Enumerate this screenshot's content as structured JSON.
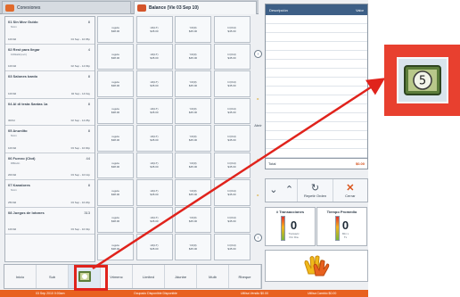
{
  "tabs": [
    {
      "label": "Conexiones"
    },
    {
      "label": "Balance (Vie 03 Sep 10)"
    }
  ],
  "info": {
    "col_desc": "Descripción",
    "col_value": "Valor",
    "total_label": "Total",
    "total_value": "$0.00"
  },
  "orders": [
    {
      "name": "01  Sin Mov Guido",
      "qty": "8",
      "sub": "Nicm",
      "time": "10h/0d",
      "date": "04 Sep - 10:05p"
    },
    {
      "name": "02  Rest para llegar",
      "qty": "4",
      "sub": "100kalin(ovn)",
      "time": "10h/3d",
      "date": "02 Sep - 14:03p"
    },
    {
      "name": "03  Salones bardo",
      "qty": "8",
      "sub": "",
      "time": "10h/0d",
      "date": "02 Sep - 14:0ay"
    },
    {
      "name": "04  Al di testa Santas 1a",
      "qty": "8",
      "sub": "",
      "time": "30/0d",
      "date": "02 Sep - 14:25p"
    },
    {
      "name": "05  Anunlito",
      "qty": "8",
      "sub": "Nicm",
      "time": "10h/0d",
      "date": "03 Sep - 10:00p"
    },
    {
      "name": "06  Fuerzo (Ctot)",
      "qty": "44",
      "sub": "DBkulin",
      "time": "20h/0d",
      "date": "03 Sep - 10:12p"
    },
    {
      "name": "07  Kanalores",
      "qty": "8",
      "sub": "Nicm",
      "time": "25h/0d",
      "date": "03 Sep - 10:20p"
    },
    {
      "name": "08  Juegos de lotones",
      "qty": "313",
      "sub": "",
      "time": "10h/0d",
      "date": "03 Sep - 10:32p"
    }
  ],
  "grid": [
    [
      "regula\n$38.00",
      "xD(LT)\n$45.00",
      "Ydl(0)\n$45.00",
      "Irr(0rd)\n$45.00"
    ],
    [
      "regula\n$38.00",
      "xD(LT)\n$45.00",
      "Ydl(0)\n$45.00",
      "Irr(0rd)\n$45.00"
    ],
    [
      "regula\n$38.00",
      "xD(LT)\n$45.00",
      "Ydl(0)\n$45.00",
      "Irr(0rd)\n$45.00"
    ],
    [
      "regula\n$38.00",
      "xD(LT)\n$45.00",
      "Ydl(0)\n$45.00",
      "Irr(0rd)\n$45.00"
    ],
    [
      "regula\n$38.00",
      "xD(LT)\n$45.00",
      "Ydl(0)\n$45.00",
      "Irr(0rd)\n$45.00"
    ],
    [
      "regula\n$38.00",
      "xD(LT)\n$45.00",
      "Ydl(0)\n$45.00",
      "Irr(0rd)\n$45.00"
    ],
    [
      "regula\n$38.00",
      "xD(LT)\n$45.00",
      "Ydl(0)\n$45.00",
      "Irr(0rd)\n$45.00"
    ],
    [
      "regula\n$38.00",
      "xD(LT)\n$45.00",
      "Ydl(0)\n$45.00",
      "Irr(0rd)\n$45.00"
    ],
    [
      "regula\n$38.00",
      "xD(LT)\n$45.00",
      "Ydl(0)\n$45.00",
      "Irr(0rd)\n$45.00"
    ]
  ],
  "side_label": "Abrir",
  "controls": {
    "refresh_label": "Repetir Orden",
    "close_label": "Cerrar"
  },
  "metrics": {
    "tx_title": "# Transacciones",
    "tx_value": "0",
    "tx_sub": "Transacc\nPor Dia",
    "time_title": "Tiempo Promedio",
    "time_value": "0",
    "time_sub": "Min x\nTx"
  },
  "categories": [
    "Inicio",
    "Sub",
    "",
    "Vrimenc",
    "Limited",
    "Jdunbe",
    "Mulb",
    "Rbeque"
  ],
  "status": {
    "left": "03 Sep 2010 0:00am",
    "center": "Ocupado  Disponible  Disponible",
    "right_a": "Utilisa Vendio $0.00",
    "right_b": "Utilisa Cambio  $0.00"
  },
  "colors": {
    "accent": "#e8611f",
    "header": "#3d5f86",
    "callout": "#e8402f"
  }
}
